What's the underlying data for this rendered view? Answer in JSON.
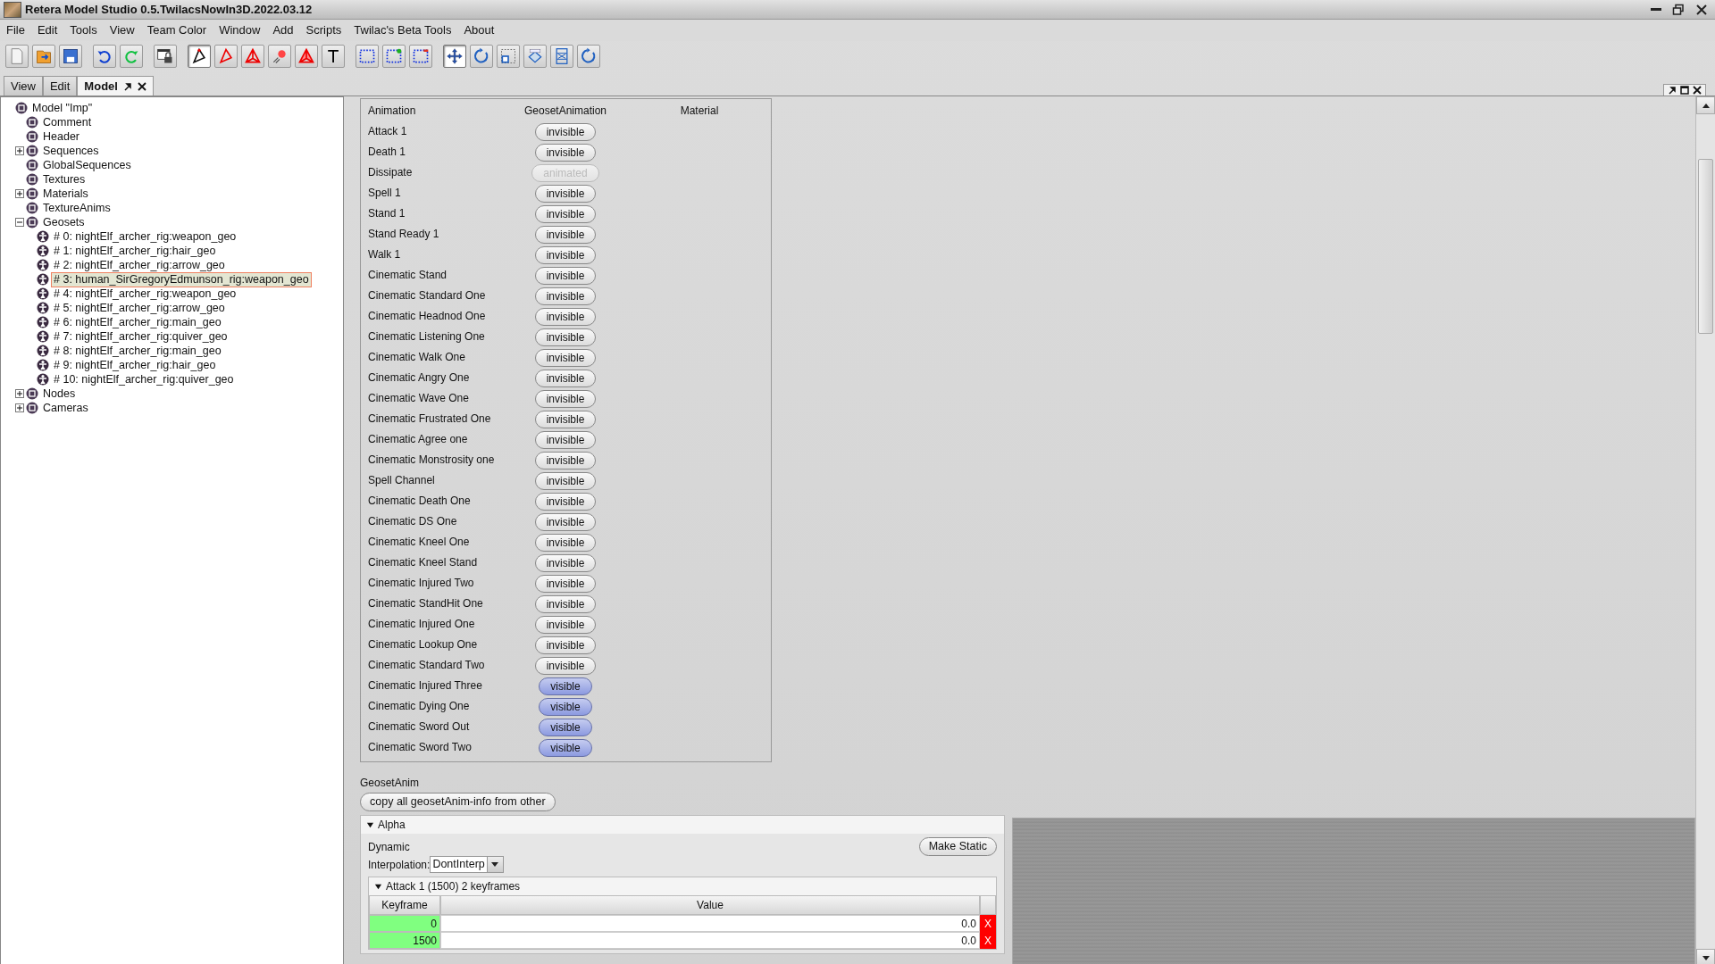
{
  "window": {
    "title": "Retera Model Studio 0.5.TwilacsNowIn3D.2022.03.12"
  },
  "menu": [
    "File",
    "Edit",
    "Tools",
    "View",
    "Team Color",
    "Window",
    "Add",
    "Scripts",
    "Twilac's Beta Tools",
    "About"
  ],
  "toolbar": [
    [
      {
        "selected": false
      },
      {
        "selected": false
      },
      {
        "selected": false
      }
    ],
    [
      {
        "selected": false
      },
      {
        "selected": false
      }
    ],
    [
      {
        "selected": false
      }
    ],
    [
      {
        "selected": true
      },
      {
        "selected": false
      },
      {
        "selected": false
      },
      {
        "selected": false
      },
      {
        "selected": false
      },
      {
        "label": "T",
        "selected": false
      }
    ],
    [
      {
        "selected": false
      },
      {
        "selected": false
      },
      {
        "selected": false
      }
    ],
    [
      {
        "selected": true
      },
      {
        "selected": false
      },
      {
        "selected": false
      },
      {
        "selected": false
      },
      {
        "selected": false
      },
      {
        "selected": false
      }
    ]
  ],
  "tabs": [
    {
      "label": "View",
      "selected": false
    },
    {
      "label": "Edit",
      "selected": false
    },
    {
      "label": "Model",
      "selected": true
    }
  ],
  "tree": {
    "label": "Model \"Imp\"",
    "selected": false,
    "children": [
      {
        "label": "Comment",
        "selected": false
      },
      {
        "label": "Header",
        "selected": false
      },
      {
        "label": "Sequences",
        "selected": false,
        "expanded": false
      },
      {
        "label": "GlobalSequences",
        "selected": false
      },
      {
        "label": "Textures",
        "selected": false
      },
      {
        "label": "Materials",
        "selected": false,
        "expanded": false
      },
      {
        "label": "TextureAnims",
        "selected": false
      },
      {
        "label": "Geosets",
        "selected": false,
        "expanded": true,
        "children": [
          {
            "label": "# 0: nightElf_archer_rig:weapon_geo",
            "selected": false
          },
          {
            "label": "# 1: nightElf_archer_rig:hair_geo",
            "selected": false
          },
          {
            "label": "# 2: nightElf_archer_rig:arrow_geo",
            "selected": false
          },
          {
            "label": "# 3: human_SirGregoryEdmunson_rig:weapon_geo",
            "selected": true
          },
          {
            "label": "# 4: nightElf_archer_rig:weapon_geo",
            "selected": false
          },
          {
            "label": "# 5: nightElf_archer_rig:arrow_geo",
            "selected": false
          },
          {
            "label": "# 6: nightElf_archer_rig:main_geo",
            "selected": false
          },
          {
            "label": "# 7: nightElf_archer_rig:quiver_geo",
            "selected": false
          },
          {
            "label": "# 8: nightElf_archer_rig:main_geo",
            "selected": false
          },
          {
            "label": "# 9: nightElf_archer_rig:hair_geo",
            "selected": false
          },
          {
            "label": "# 10: nightElf_archer_rig:quiver_geo",
            "selected": false
          }
        ]
      },
      {
        "label": "Nodes",
        "selected": false,
        "expanded": false
      },
      {
        "label": "Cameras",
        "selected": false,
        "expanded": false
      }
    ]
  },
  "anim_table": {
    "columns": [
      "Animation",
      "GeosetAnimation",
      "Material"
    ],
    "rows": [
      {
        "name": "Attack 1",
        "button": "invisible",
        "selected": false,
        "disabled": false
      },
      {
        "name": "Death 1",
        "button": "invisible",
        "selected": false,
        "disabled": false
      },
      {
        "name": "Dissipate",
        "button": "animated",
        "selected": false,
        "disabled": true
      },
      {
        "name": "Spell 1",
        "button": "invisible",
        "selected": false,
        "disabled": false
      },
      {
        "name": "Stand 1",
        "button": "invisible",
        "selected": false,
        "disabled": false
      },
      {
        "name": "Stand Ready 1",
        "button": "invisible",
        "selected": false,
        "disabled": false
      },
      {
        "name": "Walk 1",
        "button": "invisible",
        "selected": false,
        "disabled": false
      },
      {
        "name": "Cinematic Stand",
        "button": "invisible",
        "selected": false,
        "disabled": false
      },
      {
        "name": "Cinematic Standard One",
        "button": "invisible",
        "selected": false,
        "disabled": false
      },
      {
        "name": "Cinematic Headnod One",
        "button": "invisible",
        "selected": false,
        "disabled": false
      },
      {
        "name": "Cinematic Listening One",
        "button": "invisible",
        "selected": false,
        "disabled": false
      },
      {
        "name": "Cinematic Walk One",
        "button": "invisible",
        "selected": false,
        "disabled": false
      },
      {
        "name": "Cinematic Angry One",
        "button": "invisible",
        "selected": false,
        "disabled": false
      },
      {
        "name": "Cinematic Wave One",
        "button": "invisible",
        "selected": false,
        "disabled": false
      },
      {
        "name": "Cinematic Frustrated One",
        "button": "invisible",
        "selected": false,
        "disabled": false
      },
      {
        "name": "Cinematic Agree one",
        "button": "invisible",
        "selected": false,
        "disabled": false
      },
      {
        "name": "Cinematic Monstrosity one",
        "button": "invisible",
        "selected": false,
        "disabled": false
      },
      {
        "name": "Spell Channel",
        "button": "invisible",
        "selected": false,
        "disabled": false
      },
      {
        "name": "Cinematic Death One",
        "button": "invisible",
        "selected": false,
        "disabled": false
      },
      {
        "name": "Cinematic DS One",
        "button": "invisible",
        "selected": false,
        "disabled": false
      },
      {
        "name": "Cinematic Kneel One",
        "button": "invisible",
        "selected": false,
        "disabled": false
      },
      {
        "name": "Cinematic Kneel Stand",
        "button": "invisible",
        "selected": false,
        "disabled": false
      },
      {
        "name": "Cinematic Injured Two",
        "button": "invisible",
        "selected": false,
        "disabled": false
      },
      {
        "name": "Cinematic StandHit One",
        "button": "invisible",
        "selected": false,
        "disabled": false
      },
      {
        "name": "Cinematic Injured One",
        "button": "invisible",
        "selected": false,
        "disabled": false
      },
      {
        "name": "Cinematic Lookup One",
        "button": "invisible",
        "selected": false,
        "disabled": false
      },
      {
        "name": "Cinematic Standard Two",
        "button": "invisible",
        "selected": false,
        "disabled": false
      },
      {
        "name": "Cinematic Injured Three",
        "button": "visible",
        "selected": true,
        "disabled": false
      },
      {
        "name": "Cinematic Dying One",
        "button": "visible",
        "selected": true,
        "disabled": false
      },
      {
        "name": "Cinematic Sword Out",
        "button": "visible",
        "selected": true,
        "disabled": false
      },
      {
        "name": "Cinematic Sword Two",
        "button": "visible",
        "selected": true,
        "disabled": false
      }
    ]
  },
  "geoset_anim": {
    "title": "GeosetAnim",
    "copy_button": "copy all geosetAnim-info from other",
    "alpha": {
      "title": "Alpha",
      "expanded": true,
      "mode": "Dynamic",
      "make_static_button": "Make Static",
      "interpolation_label": "Interpolation:",
      "interpolation": "DontInterp",
      "sequences": [
        {
          "title": "Attack 1 (1500) 2 keyframes",
          "expanded": true,
          "columns": [
            "Keyframe",
            "Value"
          ],
          "rows": [
            {
              "keyframe": "0",
              "value": "0.0",
              "delete": "X"
            },
            {
              "keyframe": "1500",
              "value": "0.0",
              "delete": "X"
            }
          ]
        }
      ]
    }
  }
}
